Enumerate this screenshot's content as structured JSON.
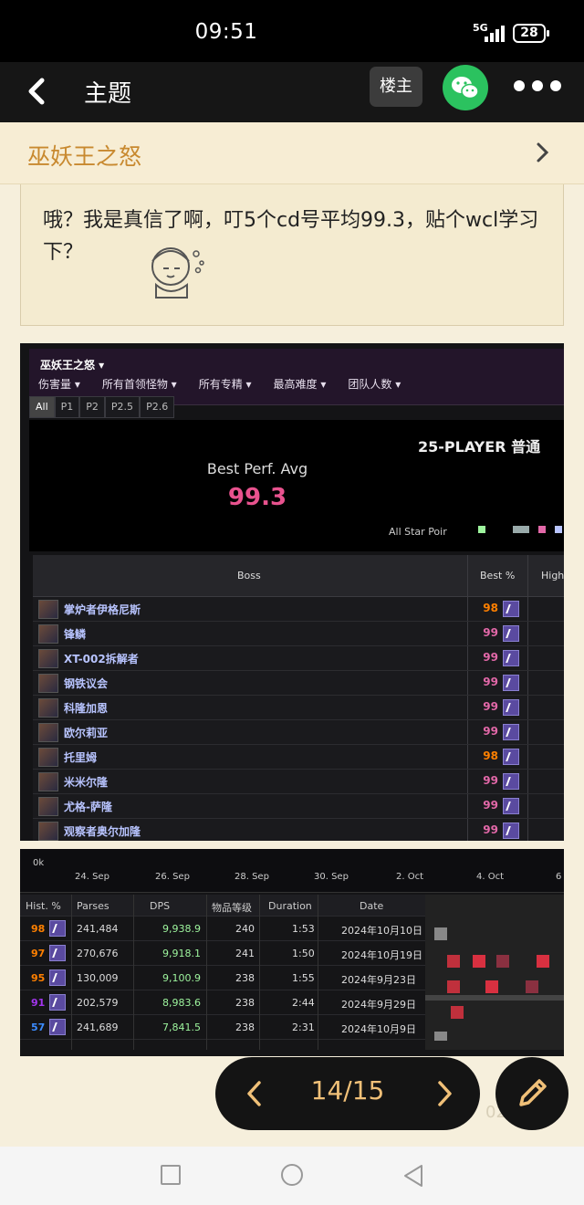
{
  "status_bar": {
    "time": "09:51",
    "network": "5G",
    "battery": "28"
  },
  "header": {
    "title": "主题",
    "owner_button": "楼主"
  },
  "forum": {
    "name": "巫妖王之怒"
  },
  "post": {
    "text": "哦？我是真信了啊，叮5个cd号平均99.3，贴个wcl学习下？"
  },
  "screenshot1": {
    "zone": "巫妖王之怒 ▾",
    "filters": [
      "伤害量 ▾",
      "所有首领怪物 ▾",
      "所有专精 ▾",
      "最高难度 ▾",
      "团队人数 ▾"
    ],
    "tabs": [
      "All",
      "P1",
      "P2",
      "P2.5",
      "P2.6"
    ],
    "difficulty": "25-PLAYER 普通",
    "best_perf_label": "Best Perf. Avg",
    "best_perf_value": "99.3",
    "all_star_label": "All Star Poir",
    "columns": {
      "boss": "Boss",
      "best": "Best %",
      "high": "High"
    },
    "bosses": [
      {
        "name": "掌炉者伊格尼斯",
        "best": "98",
        "color": "#ff8000"
      },
      {
        "name": "锋鳞",
        "best": "99",
        "color": "#e268a8"
      },
      {
        "name": "XT-002拆解者",
        "best": "99",
        "color": "#e268a8"
      },
      {
        "name": "钢铁议会",
        "best": "99",
        "color": "#e268a8"
      },
      {
        "name": "科隆加恩",
        "best": "99",
        "color": "#e268a8"
      },
      {
        "name": "欧尔莉亚",
        "best": "99",
        "color": "#e268a8"
      },
      {
        "name": "托里姆",
        "best": "98",
        "color": "#ff8000"
      },
      {
        "name": "米米尔隆",
        "best": "99",
        "color": "#e268a8"
      },
      {
        "name": "尤格-萨隆",
        "best": "99",
        "color": "#e268a8"
      },
      {
        "name": "观察者奥尔加隆",
        "best": "99",
        "color": "#e268a8"
      }
    ]
  },
  "screenshot2": {
    "axis_zero": "0k",
    "timeline_dates": [
      "24. Sep",
      "26. Sep",
      "28. Sep",
      "30. Sep",
      "2. Oct",
      "4. Oct",
      "6"
    ],
    "columns": [
      "Hist. %",
      "Parses",
      "DPS",
      "物品等级",
      "Duration",
      "Date"
    ],
    "rows": [
      {
        "hist": "98",
        "color": "#ff8000",
        "parses": "241,484",
        "dps": "9,938.9",
        "ilvl": "240",
        "duration": "1:53",
        "date": "2024年10月10日"
      },
      {
        "hist": "97",
        "color": "#ff8000",
        "parses": "270,676",
        "dps": "9,918.1",
        "ilvl": "241",
        "duration": "1:50",
        "date": "2024年10月19日"
      },
      {
        "hist": "95",
        "color": "#ff8000",
        "parses": "130,009",
        "dps": "9,100.9",
        "ilvl": "238",
        "duration": "1:55",
        "date": "2024年9月23日"
      },
      {
        "hist": "91",
        "color": "#a335ee",
        "parses": "202,579",
        "dps": "8,983.6",
        "ilvl": "238",
        "duration": "2:44",
        "date": "2024年9月29日"
      },
      {
        "hist": "57",
        "color": "#3c8cff",
        "parses": "241,689",
        "dps": "7,841.5",
        "ilvl": "238",
        "duration": "2:31",
        "date": "2024年10月9日"
      }
    ]
  },
  "pager": {
    "current": "14/15",
    "prev_icon": "chevron-left-icon",
    "next_icon": "chevron-right-icon"
  },
  "edit_icon": "pencil-icon",
  "ghost_text": "02"
}
